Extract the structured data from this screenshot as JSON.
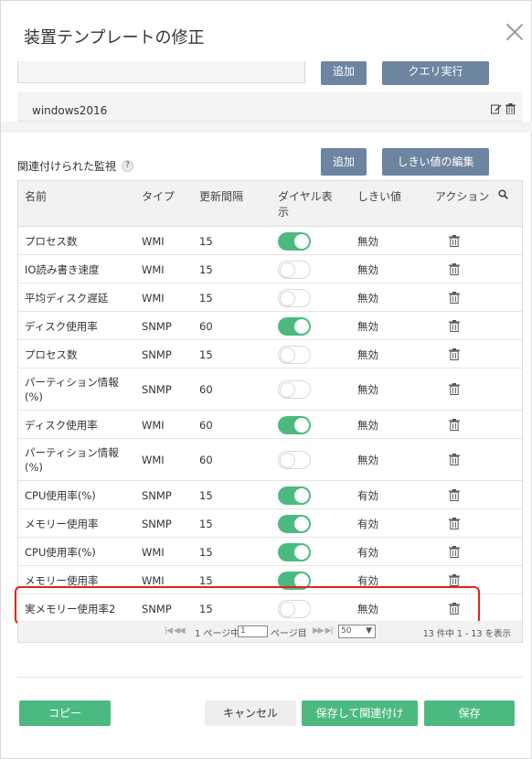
{
  "dialog": {
    "title": "装置テンプレートの修正"
  },
  "query": {
    "add_label": "追加",
    "run_label": "クエリ実行"
  },
  "device": {
    "name": "windows2016"
  },
  "monitors": {
    "section_label": "関連付けられた監視",
    "help_label": "?",
    "add_label": "追加",
    "threshold_edit_label": "しきい値の編集",
    "columns": {
      "name": "名前",
      "type": "タイプ",
      "interval": "更新間隔",
      "dial_line1": "ダイヤル表",
      "dial_line2": "示",
      "threshold": "しきい値",
      "action": "アクション"
    },
    "rows": [
      {
        "name": "プロセス数",
        "type": "WMI",
        "interval": "15",
        "dial": true,
        "threshold": "無効"
      },
      {
        "name": "IO読み書き速度",
        "type": "WMI",
        "interval": "15",
        "dial": false,
        "threshold": "無効"
      },
      {
        "name": "平均ディスク遅延",
        "type": "WMI",
        "interval": "15",
        "dial": false,
        "threshold": "無効"
      },
      {
        "name": "ディスク使用率",
        "type": "SNMP",
        "interval": "60",
        "dial": true,
        "threshold": "無効"
      },
      {
        "name": "プロセス数",
        "type": "SNMP",
        "interval": "15",
        "dial": false,
        "threshold": "無効"
      },
      {
        "name": "パーティション情報",
        "name2": "(%)",
        "type": "SNMP",
        "interval": "60",
        "dial": false,
        "threshold": "無効"
      },
      {
        "name": "ディスク使用率",
        "type": "WMI",
        "interval": "60",
        "dial": true,
        "threshold": "無効"
      },
      {
        "name": "パーティション情報",
        "name2": "(%)",
        "type": "WMI",
        "interval": "60",
        "dial": false,
        "threshold": "無効"
      },
      {
        "name": "CPU使用率(%)",
        "type": "SNMP",
        "interval": "15",
        "dial": true,
        "threshold": "有効"
      },
      {
        "name": "メモリー使用率",
        "type": "SNMP",
        "interval": "15",
        "dial": true,
        "threshold": "有効"
      },
      {
        "name": "CPU使用率(%)",
        "type": "WMI",
        "interval": "15",
        "dial": true,
        "threshold": "有効"
      },
      {
        "name": "メモリー使用率",
        "type": "WMI",
        "interval": "15",
        "dial": true,
        "threshold": "有効"
      },
      {
        "name": "実メモリー使用率2",
        "type": "SNMP",
        "interval": "15",
        "dial": false,
        "threshold": "無効"
      }
    ]
  },
  "pagination": {
    "prev_nav": "|◀ ◀◀",
    "page_prefix": "1 ページ中",
    "page_value": "1",
    "page_suffix": "ページ目",
    "next_nav": "▶▶ ▶|",
    "page_size": "50",
    "count_text": "13 件中 1 - 13 を表示"
  },
  "footer": {
    "copy_label": "コピー",
    "cancel_label": "キャンセル",
    "save_assoc_label": "保存して関連付け",
    "save_label": "保存"
  },
  "colors": {
    "accent_blue": "#6d85a1",
    "green": "#4cba80",
    "highlight": "#e0251b"
  },
  "icons": {
    "close": "close-icon",
    "edit": "edit-icon",
    "trash": "trash-icon",
    "search": "search-icon",
    "help": "help-icon"
  }
}
